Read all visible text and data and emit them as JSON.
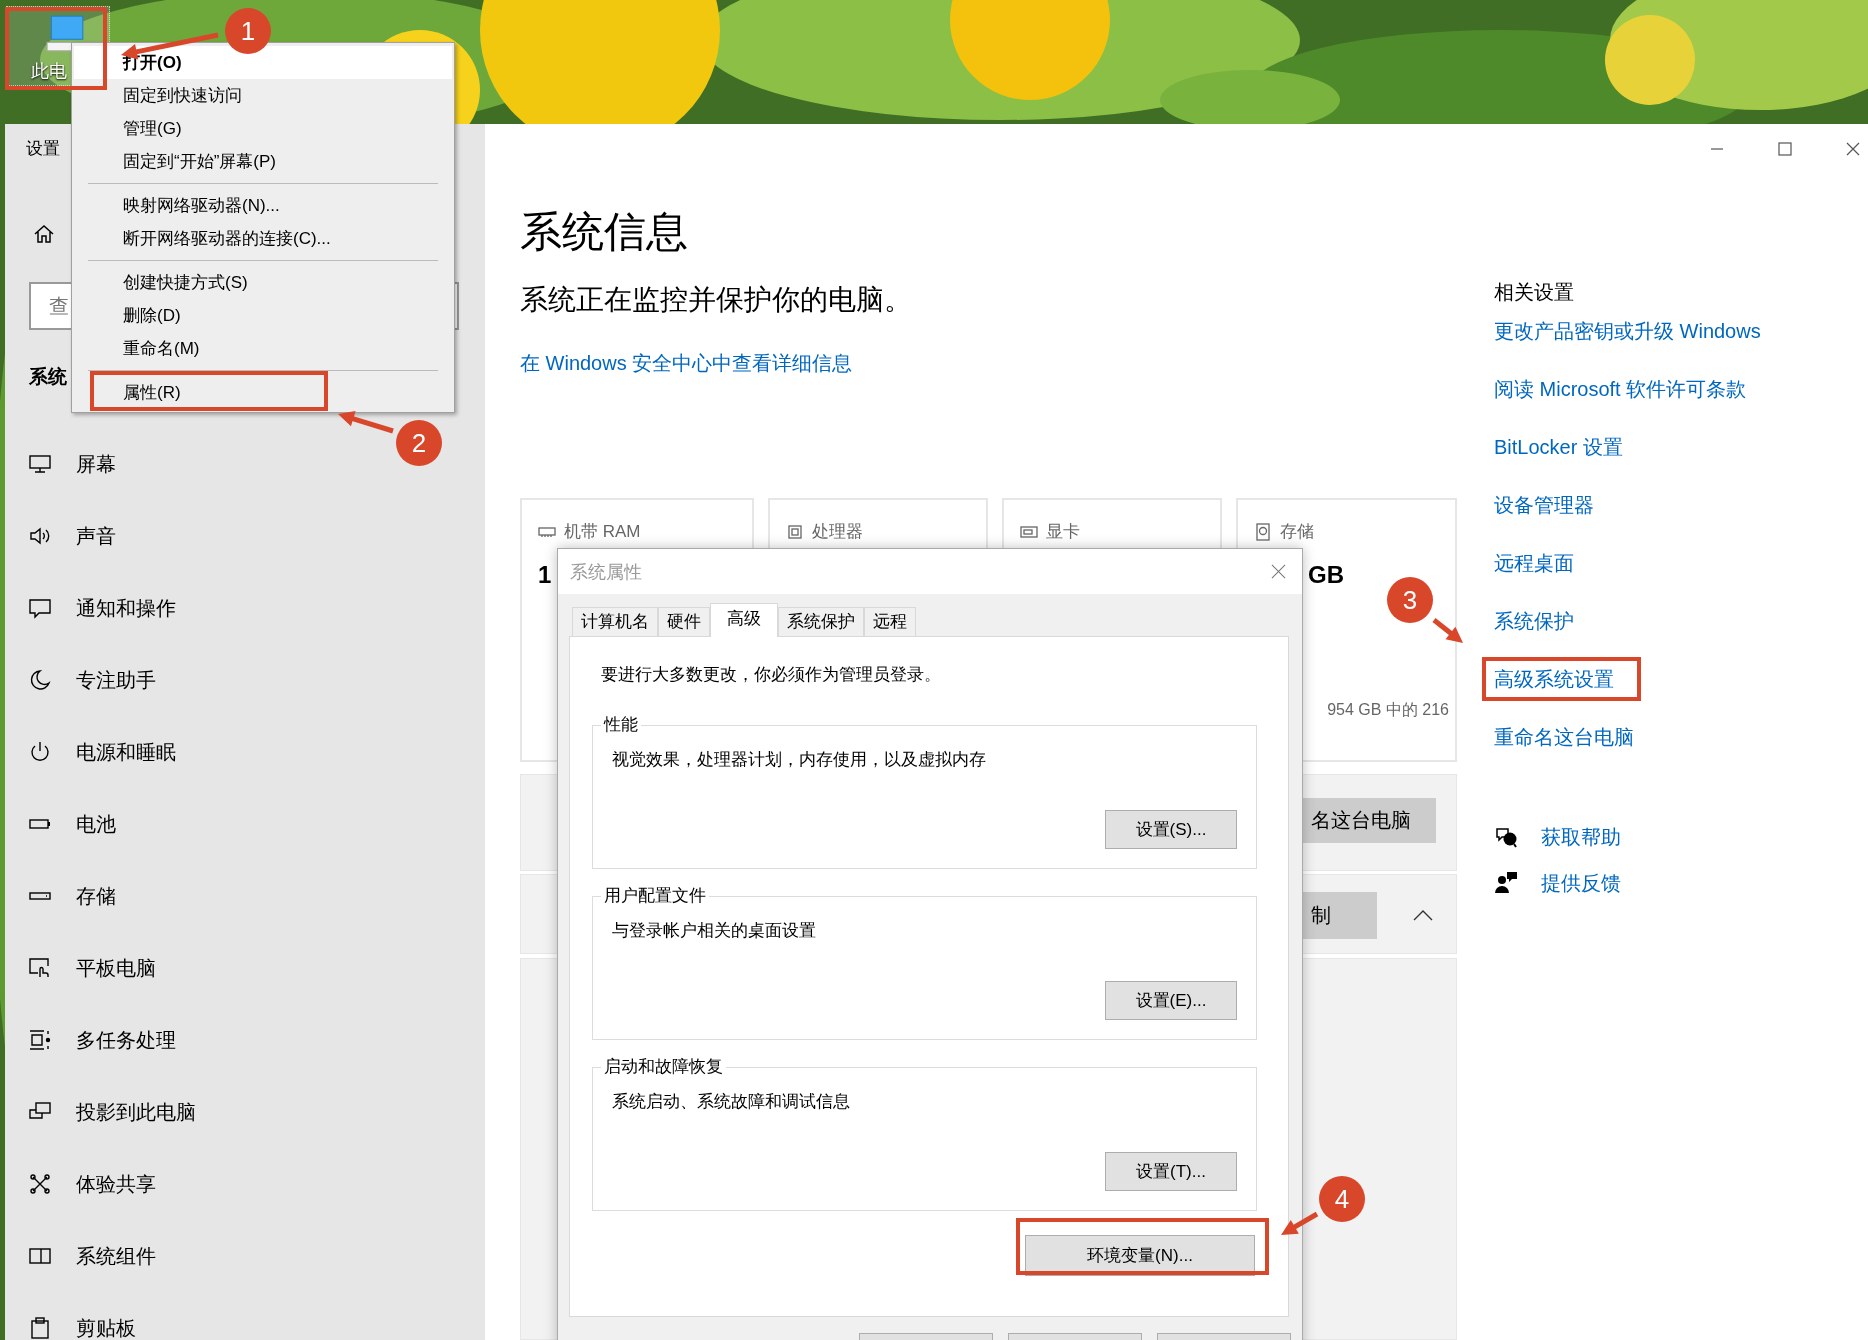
{
  "desktop": {
    "icon_label": "此电"
  },
  "context_menu": {
    "items": [
      {
        "kind": "item",
        "label": "打开(O)",
        "default": true,
        "highlighted": true
      },
      {
        "kind": "item",
        "label": "固定到快速访问",
        "default": false,
        "highlighted": false
      },
      {
        "kind": "item",
        "label": "管理(G)",
        "default": false,
        "highlighted": false
      },
      {
        "kind": "item",
        "label": "固定到“开始”屏幕(P)",
        "default": false,
        "highlighted": false
      },
      {
        "kind": "separator"
      },
      {
        "kind": "item",
        "label": "映射网络驱动器(N)...",
        "default": false,
        "highlighted": false
      },
      {
        "kind": "item",
        "label": "断开网络驱动器的连接(C)...",
        "default": false,
        "highlighted": false
      },
      {
        "kind": "separator"
      },
      {
        "kind": "item",
        "label": "创建快捷方式(S)",
        "default": false,
        "highlighted": false
      },
      {
        "kind": "item",
        "label": "删除(D)",
        "default": false,
        "highlighted": false
      },
      {
        "kind": "item",
        "label": "重命名(M)",
        "default": false,
        "highlighted": false
      },
      {
        "kind": "separator"
      },
      {
        "kind": "item",
        "label": "属性(R)",
        "default": false,
        "highlighted": false
      }
    ]
  },
  "settings": {
    "app_title": "设置",
    "search": {
      "placeholder": "查"
    },
    "section": "系统",
    "nav": [
      {
        "label": "屏幕"
      },
      {
        "label": "声音"
      },
      {
        "label": "通知和操作"
      },
      {
        "label": "专注助手"
      },
      {
        "label": "电源和睡眠"
      },
      {
        "label": "电池"
      },
      {
        "label": "存储"
      },
      {
        "label": "平板电脑"
      },
      {
        "label": "多任务处理"
      },
      {
        "label": "投影到此电脑"
      },
      {
        "label": "体验共享"
      },
      {
        "label": "系统组件"
      },
      {
        "label": "剪贴板"
      }
    ]
  },
  "main": {
    "title": "系统信息",
    "subtitle": "系统正在监控并保护你的电脑。",
    "security_link": "在 Windows 安全中心中查看详细信息",
    "cards": [
      {
        "label": "机带 RAM",
        "value": "1"
      },
      {
        "label": "处理器"
      },
      {
        "label": "显卡"
      },
      {
        "label": "存储",
        "value": "GB",
        "detail": "954 GB 中的 216"
      }
    ],
    "rename_button": "名这台电脑",
    "copy_button": "制"
  },
  "related": {
    "heading": "相关设置",
    "links": [
      "更改产品密钥或升级 Windows",
      "阅读 Microsoft 软件许可条款",
      "BitLocker 设置",
      "设备管理器",
      "远程桌面",
      "系统保护",
      "高级系统设置",
      "重命名这台电脑"
    ],
    "help": [
      {
        "label": "获取帮助"
      },
      {
        "label": "提供反馈"
      }
    ]
  },
  "dialog": {
    "title": "系统属性",
    "tabs": [
      {
        "label": "计算机名",
        "selected": false
      },
      {
        "label": "硬件",
        "selected": false
      },
      {
        "label": "高级",
        "selected": true
      },
      {
        "label": "系统保护",
        "selected": false
      },
      {
        "label": "远程",
        "selected": false
      }
    ],
    "notice": "要进行大多数更改，你必须作为管理员登录。",
    "groups": [
      {
        "legend": "性能",
        "description": "视觉效果，处理器计划，内存使用，以及虚拟内存",
        "button": "设置(S)..."
      },
      {
        "legend": "用户配置文件",
        "description": "与登录帐户相关的桌面设置",
        "button": "设置(E)..."
      },
      {
        "legend": "启动和故障恢复",
        "description": "系统启动、系统故障和调试信息",
        "button": "设置(T)..."
      }
    ],
    "env_button": "环境变量(N)..."
  },
  "annotations": [
    {
      "number": "1"
    },
    {
      "number": "2"
    },
    {
      "number": "3"
    },
    {
      "number": "4"
    }
  ]
}
